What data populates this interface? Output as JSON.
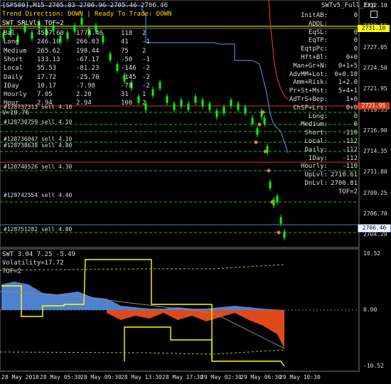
{
  "header": {
    "symbol_info": "[SP500],M15  2705.83 2706.96 2705.46 2706.46",
    "trend_direction": "Trend Direction:  DOWN   |   Ready To Trade:  DOWN",
    "swt_line": "SWT_SRLVls_TOF=2",
    "ea_name": "SWTv5_Full_Exp"
  },
  "stats_table": {
    "rows": [
      {
        "label": "Bal",
        "c1": "4507.60",
        "c2": "1774.46",
        "c3": "118",
        "c4": "2"
      },
      {
        "label": "Long",
        "c1": "246.10",
        "c2": "266.03",
        "c3": "41",
        "c4": "-1"
      },
      {
        "label": "Medium",
        "c1": "265.62",
        "c2": "198.44",
        "c3": "75",
        "c4": "2"
      },
      {
        "label": "Short",
        "c1": "133.13",
        "c2": "-67.17",
        "c3": "-50",
        "c4": "-1"
      },
      {
        "label": "Local",
        "c1": "55.53",
        "c2": "-81.23",
        "c3": "-146",
        "c4": "-2"
      },
      {
        "label": "Daily",
        "c1": "17.72",
        "c2": "-25.70",
        "c3": "-145",
        "c4": "-2"
      },
      {
        "label": "IDay",
        "c1": "10.17",
        "c2": "-7.98",
        "c3": "-78",
        "c4": "-2"
      },
      {
        "label": "Hourly",
        "c1": "7.05",
        "c2": "2.20",
        "c3": "31",
        "c4": "1"
      },
      {
        "label": "Hour",
        "c1": "2.94",
        "c2": "2.94",
        "c3": "100",
        "c4": "2"
      }
    ]
  },
  "ea_panel": {
    "rows": [
      {
        "label": "InitAB:",
        "value": "0"
      },
      {
        "label": "ADDL:",
        "value": ""
      },
      {
        "label": "EqSL:",
        "value": "0"
      },
      {
        "label": "EqTP:",
        "value": "0"
      },
      {
        "label": "EqtpPc:",
        "value": "0"
      },
      {
        "label": "Hft+Bl:",
        "value": "0+0"
      },
      {
        "label": "Man+Gr+N:",
        "value": "0+1+5"
      },
      {
        "label": "AdvMM+Lot:",
        "value": "0+0.10"
      },
      {
        "label": "Amm+Risk:",
        "value": "1+2.0"
      },
      {
        "label": "Pr+St+Mst:",
        "value": "5+4+1"
      },
      {
        "label": "AdTrS+Bep:",
        "value": "1+0"
      },
      {
        "label": "ChSP+Lrs:",
        "value": "0+0"
      },
      {
        "label": "Long:",
        "value": "0"
      },
      {
        "label": "Medium:",
        "value": "0"
      },
      {
        "label": "Short:",
        "value": "-110"
      },
      {
        "label": "Local:",
        "value": "-112"
      },
      {
        "label": "Daily:",
        "value": "-112"
      },
      {
        "label": "IDay:",
        "value": "-112"
      },
      {
        "label": "Hourly:",
        "value": "-110"
      },
      {
        "label": "UpLvl:",
        "value": "2710.61"
      },
      {
        "label": "DnLvl:",
        "value": "2700.81"
      },
      {
        "label": "",
        "value": "TOF=2"
      }
    ]
  },
  "v_label": "V=10.76",
  "orders": [
    "#128737313 sell 4.10",
    "#128730759 sell 4.10",
    "#128736047 sell 4.10",
    "#128738638 sell 4.80",
    "#128740526 sell 4.30",
    "#128742554 sell 4.40",
    "#128751282 sell 4.80"
  ],
  "price_axis": [
    "2732.10",
    "2729.55",
    "2727.05",
    "2724.50",
    "2721.95",
    "2719.35",
    "2716.90",
    "2714.35",
    "2711.80",
    "2709.25",
    "2706.70",
    "2704.20"
  ],
  "price_tags": {
    "upper_yellow": "2731.10",
    "red": "2721.95",
    "current": "2706.46"
  },
  "indicator": {
    "title": "SWT  3.04  7.25  -5.49",
    "volatility": "Volatility=17.72",
    "tof": "TOF=2",
    "axis": [
      "10.52",
      "0.00",
      "-10.52"
    ]
  },
  "time_axis": [
    "28 May 2018",
    "28 May 05:30",
    "28 May 09:30",
    "28 May 13:30",
    "28 May 17:30",
    "29 May 02:30",
    "29 May 06:30",
    "29 May 10:30"
  ],
  "colors": {
    "bg": "#000000",
    "candle": "#00ff00",
    "blue_line": "#4a7fd4",
    "red_line": "#d43a1a",
    "yellow": "#ffff00",
    "grid_dash": "#00cc00"
  }
}
